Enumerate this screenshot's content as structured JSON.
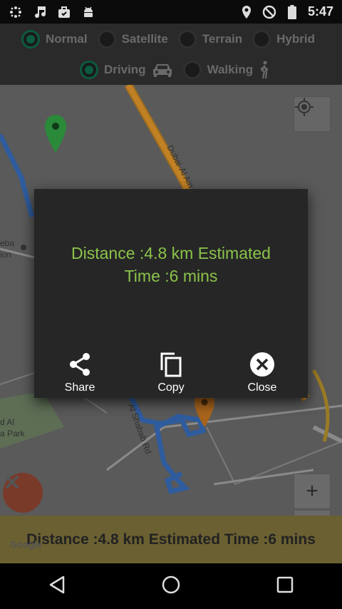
{
  "status_bar": {
    "time": "5:47",
    "left_icons": [
      "dots-icon",
      "music-note-icon",
      "briefcase-icon",
      "android-icon"
    ],
    "right_icons": [
      "location-icon",
      "do-not-disturb-icon",
      "battery-icon"
    ]
  },
  "map_type": {
    "options": [
      {
        "label": "Normal",
        "checked": true
      },
      {
        "label": "Satellite",
        "checked": false
      },
      {
        "label": "Terrain",
        "checked": false
      },
      {
        "label": "Hybrid",
        "checked": false
      }
    ]
  },
  "travel_mode": {
    "options": [
      {
        "label": "Driving",
        "checked": true,
        "icon": "car-icon"
      },
      {
        "label": "Walking",
        "checked": false,
        "icon": "walking-icon"
      }
    ]
  },
  "map": {
    "labels": {
      "road_dubai": "Dubai-Al Ain",
      "road_shababi": "Al Shabab Rd",
      "place_left_1": "eba",
      "place_left_2": "ion",
      "park_1": "d Al",
      "park_2": "a Park"
    },
    "zoom_in": "+",
    "zoom_out": "−",
    "google_logo": "Google"
  },
  "distance_bar": {
    "text": "Distance :4.8 km  Estimated Time :6 mins"
  },
  "dialog": {
    "message_line1": "Distance :4.8 km  Estimated",
    "message_line2": "Time :6 mins",
    "actions": {
      "share": "Share",
      "copy": "Copy",
      "close": "Close"
    }
  },
  "colors": {
    "accent_green": "#8bc34a",
    "radio_green": "#0c5a3f",
    "route_blue": "#3b7bd8",
    "road_orange": "#d08a1e"
  }
}
